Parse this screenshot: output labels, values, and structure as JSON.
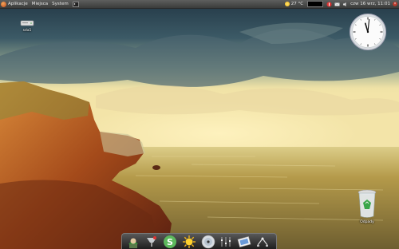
{
  "top_panel": {
    "menus": [
      "Aplikacje",
      "Miejsca",
      "System"
    ],
    "temperature": "27 °C",
    "datetime": "czw 16 wrz, 11:01"
  },
  "desktop": {
    "drive_label": "sda1",
    "trash_label": "Odpady"
  },
  "clock_widget": {
    "time": "11:01"
  },
  "dock": {
    "items": [
      "file-manager-icon",
      "terminal-icon",
      "skype-icon",
      "weather-sun-icon",
      "cd-dvd-icon",
      "tuner-icon",
      "image-viewer-icon",
      "network-icon"
    ]
  },
  "colors": {
    "panel": "#4a4b4a",
    "sky_top": "#1f3440",
    "sky_glow": "#efe0a0",
    "sea": "#a58a3a",
    "cliff": "#b65a1e"
  }
}
